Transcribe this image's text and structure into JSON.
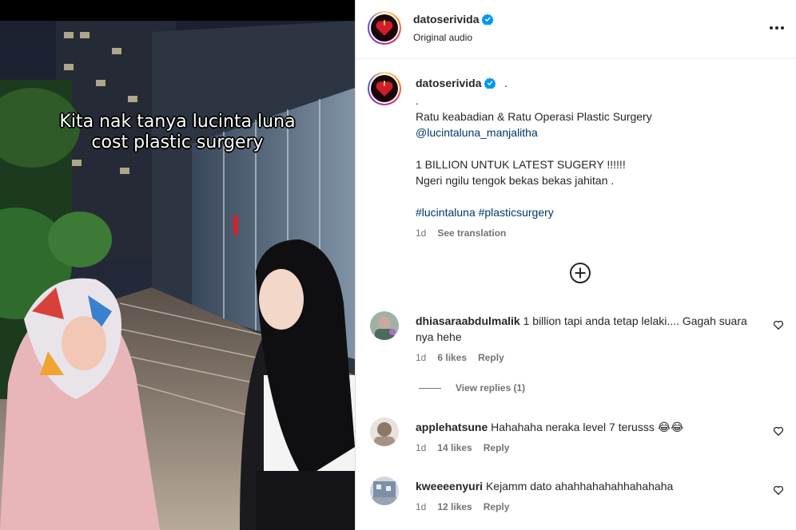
{
  "video": {
    "caption_line1": "Kita nak tanya lucinta luna",
    "caption_line2": "cost plastic surgery"
  },
  "header": {
    "username": "datoserivida",
    "subtitle": "Original audio",
    "more_icon": "more-horizontal-icon"
  },
  "post": {
    "username": "datoserivida",
    "after_name": ".",
    "lines": [
      ".",
      "Ratu keabadian & Ratu Operasi Plastic Surgery",
      "@lucintaluna_manjalitha",
      "",
      "1 BILLION UNTUK LATEST SUGERY !!!!!!",
      "Ngeri ngilu tengok bekas bekas jahitan .",
      "",
      "#lucintaluna #plasticsurgery"
    ],
    "time": "1d",
    "see_translation": "See translation"
  },
  "load_more_icon": "plus-circle-icon",
  "comments": [
    {
      "username": "dhiasaraabdulmalik",
      "text": "1 billion tapi anda tetap lelaki.... Gagah suara nya hehe",
      "time": "1d",
      "likes": "6 likes",
      "reply": "Reply"
    },
    {
      "username": "applehatsune",
      "text": "Hahahaha neraka level 7 terusss 😂😂",
      "time": "1d",
      "likes": "14 likes",
      "reply": "Reply"
    },
    {
      "username": "kweeeenyuri",
      "text": "Kejamm dato ahahhahahahhahahaha",
      "time": "1d",
      "likes": "12 likes",
      "reply": "Reply"
    }
  ],
  "view_replies": "View replies (1)",
  "colors": {
    "verified": "#0095f6",
    "link": "#00376b",
    "muted": "#737373"
  }
}
